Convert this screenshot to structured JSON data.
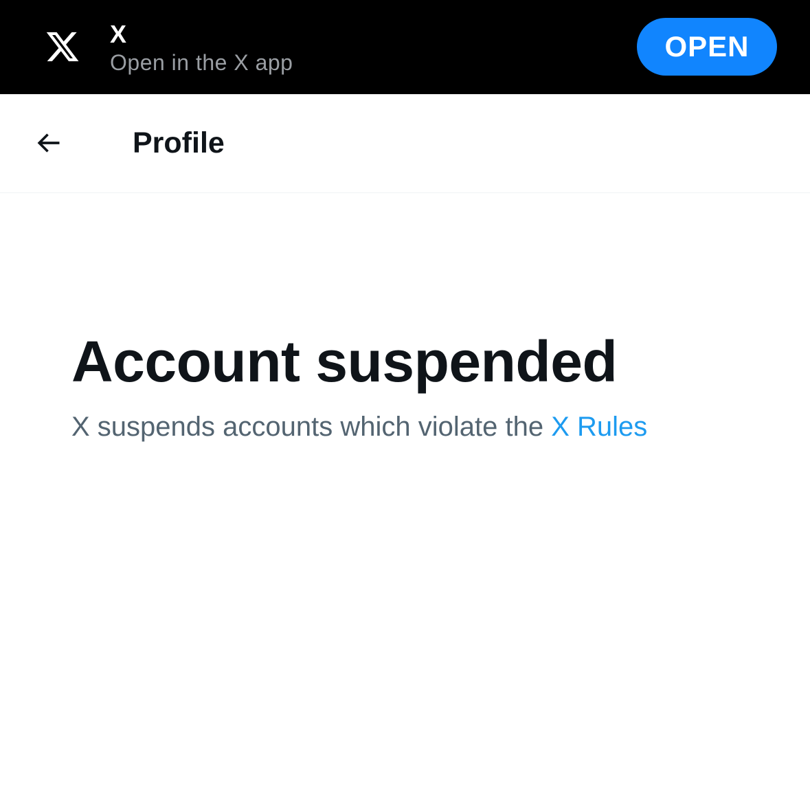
{
  "app_banner": {
    "title": "X",
    "subtitle": "Open in the X app",
    "open_label": "OPEN",
    "logo_icon": "x-logo-icon",
    "button_color": "#1185fe"
  },
  "header": {
    "back_icon": "arrow-left-icon",
    "title": "Profile"
  },
  "main": {
    "title": "Account suspended",
    "message_prefix": "X suspends accounts which violate the",
    "rules_link_label": "X Rules",
    "link_color": "#1d9bf0"
  }
}
